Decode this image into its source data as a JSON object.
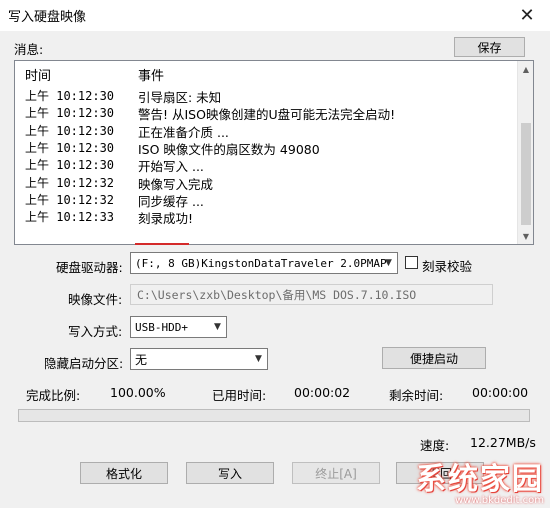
{
  "window": {
    "title": "写入硬盘映像",
    "close_glyph": "✕"
  },
  "messages": {
    "label": "消息:",
    "save_button": "保存",
    "headers": {
      "time": "时间",
      "event": "事件"
    },
    "rows": [
      {
        "time": "上午 10:12:30",
        "event": "引导扇区: 未知"
      },
      {
        "time": "上午 10:12:30",
        "event": "警告! 从ISO映像创建的U盘可能无法完全启动!"
      },
      {
        "time": "上午 10:12:30",
        "event": "正在准备介质 ..."
      },
      {
        "time": "上午 10:12:30",
        "event": "ISO 映像文件的扇区数为 49080"
      },
      {
        "time": "上午 10:12:30",
        "event": "开始写入 ..."
      },
      {
        "time": "上午 10:12:32",
        "event": "映像写入完成"
      },
      {
        "time": "上午 10:12:32",
        "event": "同步缓存 ..."
      },
      {
        "time": "上午 10:12:33",
        "event": "刻录成功!"
      }
    ]
  },
  "drive": {
    "label": "硬盘驱动器:",
    "value": "(F:, 8 GB)KingstonDataTraveler 2.0PMAP",
    "verify_label": "刻录校验",
    "verify_checked": false
  },
  "image_file": {
    "label": "映像文件:",
    "value": "C:\\Users\\zxb\\Desktop\\备用\\MS DOS.7.10.ISO"
  },
  "write_mode": {
    "label": "写入方式:",
    "value": "USB-HDD+"
  },
  "hidden_partition": {
    "label": "隐藏启动分区:",
    "value": "无",
    "quick_boot_button": "便捷启动"
  },
  "stats": {
    "complete_label": "完成比例:",
    "complete_value": "100.00%",
    "elapsed_label": "已用时间:",
    "elapsed_value": "00:00:02",
    "remaining_label": "剩余时间:",
    "remaining_value": "00:00:00",
    "progress_fraction": 0.0,
    "speed_label": "速度:",
    "speed_value": "12.27MB/s"
  },
  "buttons": {
    "format": "格式化",
    "write": "写入",
    "stop": "终止[A]",
    "return": "返回"
  },
  "watermark": {
    "main": "系统家园",
    "sub": "www.bkdedit.com"
  },
  "colors": {
    "progress_fill": "#06b025",
    "underline": "#d42a2a"
  }
}
